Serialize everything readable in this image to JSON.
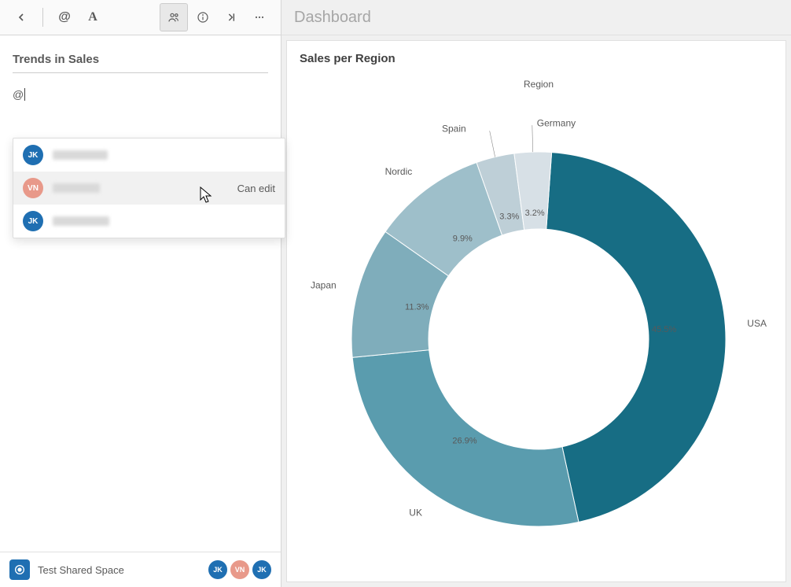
{
  "sidebar": {
    "note_title": "Trends in Sales",
    "mention_trigger": "@",
    "toolbar": {
      "back_icon": "chevron-left",
      "mention_icon": "at-sign",
      "text_style_icon": "letter-A",
      "people_icon": "people",
      "info_icon": "info",
      "collapse_icon": "collapse-right",
      "more_icon": "more-horizontal"
    },
    "mention_popup": {
      "visible": true,
      "items": [
        {
          "initials": "JK",
          "color": "blue",
          "name_blurred": true,
          "blur_width": 70,
          "permission": ""
        },
        {
          "initials": "VN",
          "color": "salmon",
          "name_blurred": true,
          "blur_width": 60,
          "permission": "Can edit",
          "highlight": true
        },
        {
          "initials": "JK",
          "color": "blue",
          "name_blurred": true,
          "blur_width": 72,
          "permission": ""
        }
      ]
    },
    "footer": {
      "space_name": "Test Shared Space",
      "avatars": [
        {
          "initials": "JK",
          "color": "blue"
        },
        {
          "initials": "VN",
          "color": "salmon"
        },
        {
          "initials": "JK",
          "color": "blue"
        }
      ]
    }
  },
  "main": {
    "header": "Dashboard",
    "card_title": "Sales per Region",
    "chart_legend_title": "Region"
  },
  "chart_data": {
    "type": "pie",
    "title": "Sales per Region",
    "legend_title": "Region",
    "donut": true,
    "series": [
      {
        "name": "USA",
        "pct": 45.5,
        "color": "#176d84"
      },
      {
        "name": "UK",
        "pct": 26.9,
        "color": "#5a9cae"
      },
      {
        "name": "Japan",
        "pct": 11.3,
        "color": "#7fadbb"
      },
      {
        "name": "Nordic",
        "pct": 9.9,
        "color": "#9ebfca"
      },
      {
        "name": "Spain",
        "pct": 3.3,
        "color": "#becfd7"
      },
      {
        "name": "Germany",
        "pct": 3.2,
        "color": "#d7e0e6"
      }
    ]
  }
}
